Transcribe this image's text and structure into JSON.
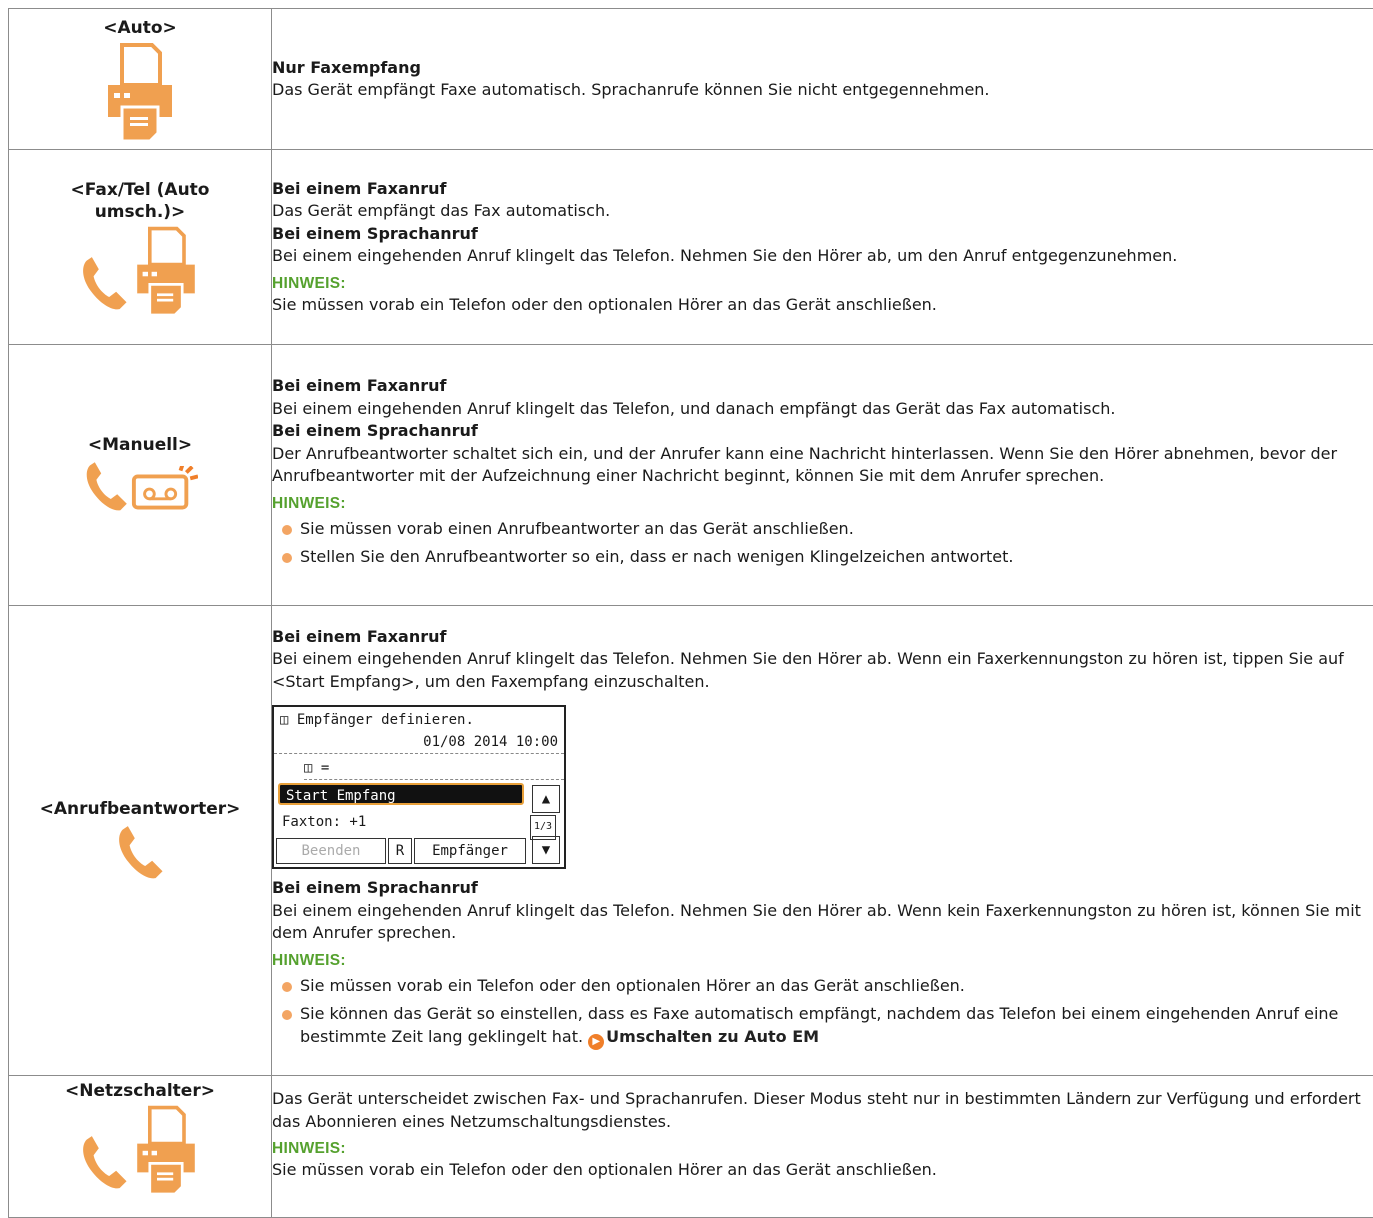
{
  "rows": [
    {
      "mode": "<Auto>",
      "lines": {
        "h1": "Nur Faxempfang",
        "t1": "Das Gerät empfängt Faxe automatisch. Sprachanrufe können Sie nicht entgegennehmen."
      }
    },
    {
      "mode": "<Fax/Tel (Auto umsch.)>",
      "lines": {
        "h1": "Bei einem Faxanruf",
        "t1": "Das Gerät empfängt das Fax automatisch.",
        "h2": "Bei einem Sprachanruf",
        "t2": "Bei einem eingehenden Anruf klingelt das Telefon. Nehmen Sie den Hörer ab, um den Anruf entgegenzunehmen.",
        "note": "HINWEIS:",
        "n1": "Sie müssen vorab ein Telefon oder den optionalen Hörer an das Gerät anschließen."
      }
    },
    {
      "mode": "<Manuell>",
      "lines": {
        "h1": "Bei einem Faxanruf",
        "t1": "Bei einem eingehenden Anruf klingelt das Telefon, und danach empfängt das Gerät das Fax automatisch.",
        "h2": "Bei einem Sprachanruf",
        "t2": "Der Anrufbeantworter schaltet sich ein, und der Anrufer kann eine Nachricht hinterlassen. Wenn Sie den Hörer abnehmen, bevor der Anrufbeantworter mit der Aufzeichnung einer Nachricht beginnt, können Sie mit dem Anrufer sprechen.",
        "note": "HINWEIS:",
        "b1": "Sie müssen vorab einen Anrufbeantworter an das Gerät anschließen.",
        "b2": "Stellen Sie den Anrufbeantworter so ein, dass er nach wenigen Klingelzeichen antwortet."
      }
    },
    {
      "mode": "<Anrufbeantworter>",
      "lines": {
        "h1": "Bei einem Faxanruf",
        "t1": "Bei einem eingehenden Anruf klingelt das Telefon. Nehmen Sie den Hörer ab. Wenn ein Faxerkennungston zu hören ist, tippen Sie auf <Start Empfang>, um den Faxempfang einzuschalten.",
        "h2": "Bei einem Sprachanruf",
        "t2": "Bei einem eingehenden Anruf klingelt das Telefon. Nehmen Sie den Hörer ab. Wenn kein Faxerkennungston zu hören ist, können Sie mit dem Anrufer sprechen.",
        "note": "HINWEIS:",
        "b1": "Sie müssen vorab ein Telefon oder den optionalen Hörer an das Gerät anschließen.",
        "b2": "Sie können das Gerät so einstellen, dass es Faxe automatisch empfängt, nachdem das Telefon bei einem eingehenden Anruf eine bestimmte Zeit lang geklingelt hat.",
        "link": "Umschalten zu Auto EM"
      },
      "lcd": {
        "title": "Empfänger definieren.",
        "datetime": "01/08 2014 10:00",
        "field": "=",
        "selected": "Start Empfang",
        "item2": "Faxton: +1",
        "page": "1/3",
        "btn_end": "Beenden",
        "btn_r": "R",
        "btn_recipient": "Empfänger"
      }
    },
    {
      "mode": "<Netzschalter>",
      "lines": {
        "t1": "Das Gerät unterscheidet zwischen Fax- und Sprachanrufen. Dieser Modus steht nur in bestimmten Ländern zur Verfügung und erfordert das Abonnieren eines Netzumschaltungsdienstes.",
        "note": "HINWEIS:",
        "n1": "Sie müssen vorab ein Telefon oder den optionalen Hörer an das Gerät anschließen."
      }
    }
  ],
  "colors": {
    "accent": "#f3a563",
    "note": "#55a12e",
    "border": "#8c8c8c"
  }
}
